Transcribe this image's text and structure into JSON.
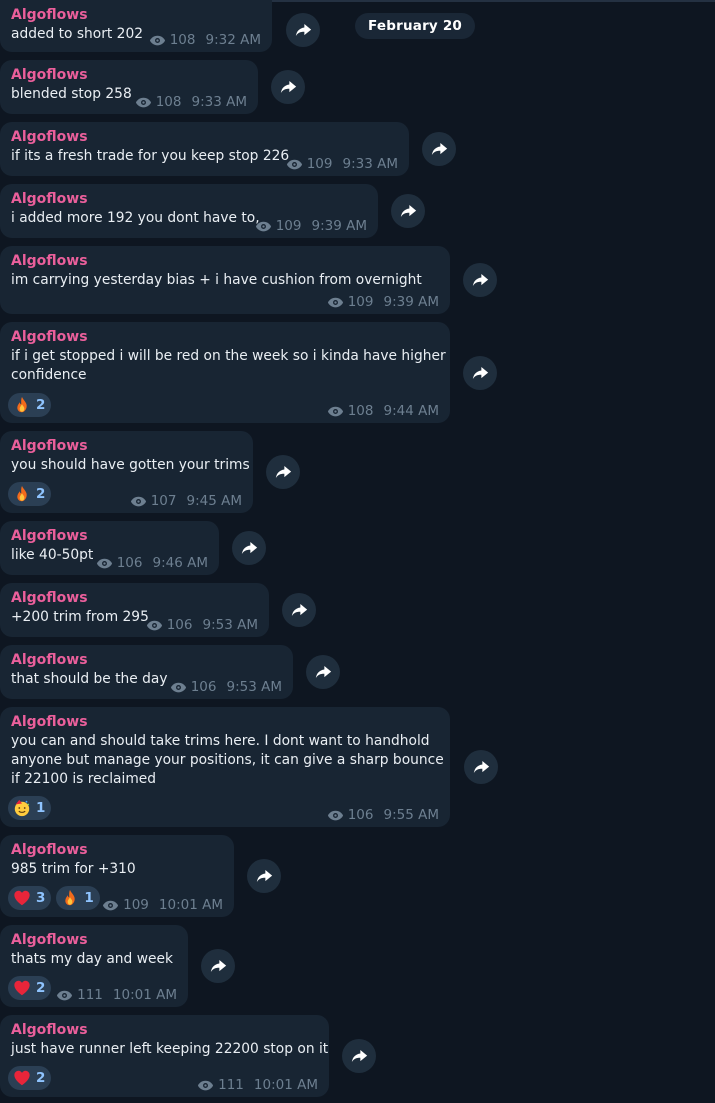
{
  "date_separator": "February 20",
  "messages": [
    {
      "sender": "Algoflows",
      "lines": [
        "added to short  202"
      ],
      "views": "108",
      "time": "9:32 AM",
      "reactions": []
    },
    {
      "sender": "Algoflows",
      "lines": [
        "blended stop 258"
      ],
      "views": "108",
      "time": "9:33 AM",
      "reactions": []
    },
    {
      "sender": "Algoflows",
      "lines": [
        "if its a fresh trade for you keep stop 226"
      ],
      "views": "109",
      "time": "9:33 AM",
      "reactions": []
    },
    {
      "sender": "Algoflows",
      "lines": [
        "i added more 192 you dont have to,"
      ],
      "views": "109",
      "time": "9:39 AM",
      "reactions": []
    },
    {
      "sender": "Algoflows",
      "lines": [
        "im carrying yesterday bias + i have cushion from overnight"
      ],
      "views": "109",
      "time": "9:39 AM",
      "reactions": []
    },
    {
      "sender": "Algoflows",
      "lines": [
        "if i get stopped i will be red on the week so i kinda have higher",
        "confidence"
      ],
      "views": "108",
      "time": "9:44 AM",
      "reactions": [
        {
          "emoji": "fire",
          "count": "2"
        }
      ]
    },
    {
      "sender": "Algoflows",
      "lines": [
        "you should have gotten your trims"
      ],
      "views": "107",
      "time": "9:45 AM",
      "reactions": [
        {
          "emoji": "fire",
          "count": "2"
        }
      ]
    },
    {
      "sender": "Algoflows",
      "lines": [
        "like 40-50pt"
      ],
      "views": "106",
      "time": "9:46 AM",
      "reactions": []
    },
    {
      "sender": "Algoflows",
      "lines": [
        "+200 trim from 295"
      ],
      "views": "106",
      "time": "9:53 AM",
      "reactions": []
    },
    {
      "sender": "Algoflows",
      "lines": [
        "that should be the day"
      ],
      "views": "106",
      "time": "9:53 AM",
      "reactions": []
    },
    {
      "sender": "Algoflows",
      "lines": [
        "you can and should take trims here. I dont want to handhold",
        "anyone but manage your positions, it can give a sharp bounce",
        "if 22100 is reclaimed"
      ],
      "views": "106",
      "time": "9:55 AM",
      "reactions": [
        {
          "emoji": "party-face",
          "count": "1"
        }
      ]
    },
    {
      "sender": "Algoflows",
      "lines": [
        "985 trim for +310"
      ],
      "views": "109",
      "time": "10:01 AM",
      "reactions": [
        {
          "emoji": "heart",
          "count": "3"
        },
        {
          "emoji": "fire",
          "count": "1"
        }
      ]
    },
    {
      "sender": "Algoflows",
      "lines": [
        "thats my day and week"
      ],
      "views": "111",
      "time": "10:01 AM",
      "reactions": [
        {
          "emoji": "heart",
          "count": "2"
        }
      ]
    },
    {
      "sender": "Algoflows",
      "lines": [
        "just have runner left keeping 22200 stop on it"
      ],
      "views": "111",
      "time": "10:01 AM",
      "reactions": [
        {
          "emoji": "heart",
          "count": "2"
        }
      ]
    }
  ]
}
